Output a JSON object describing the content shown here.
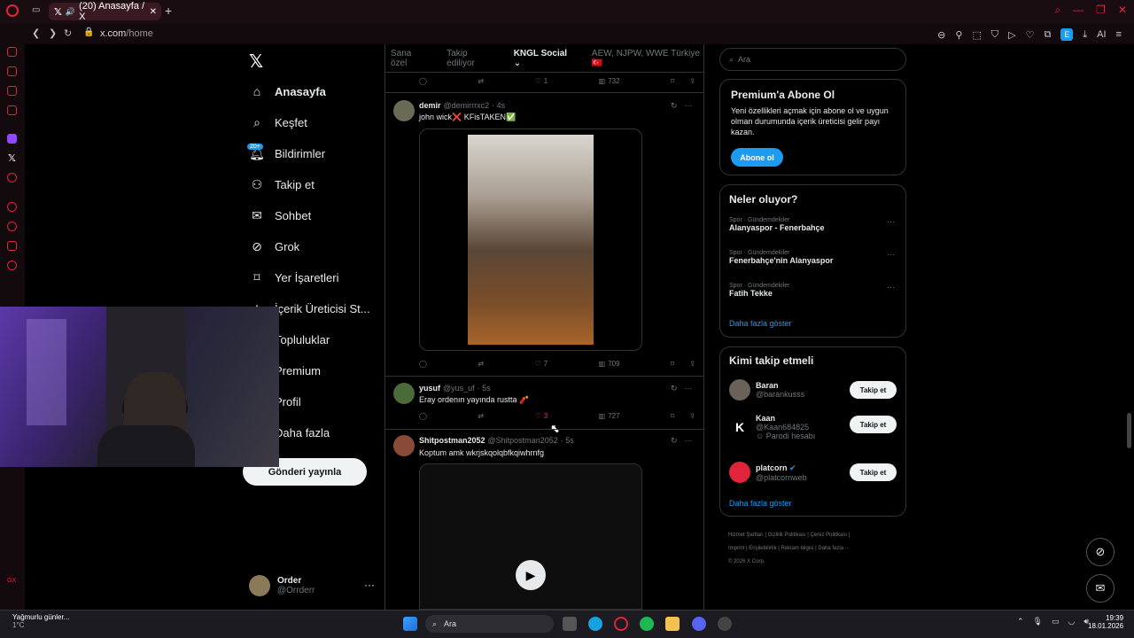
{
  "browser": {
    "tab_title": "(20) Anasayfa / X",
    "url_host": "x.com",
    "url_path": "/home",
    "ext_letter": "E",
    "ai_label": "AI"
  },
  "nav": {
    "logo": "𝕏",
    "items": [
      {
        "label": "Anasayfa",
        "icon": "home-icon"
      },
      {
        "label": "Keşfet",
        "icon": "search-icon"
      },
      {
        "label": "Bildirimler",
        "icon": "bell-icon"
      },
      {
        "label": "Takip et",
        "icon": "follow-icon"
      },
      {
        "label": "Sohbet",
        "icon": "mail-icon"
      },
      {
        "label": "Grok",
        "icon": "grok-icon"
      },
      {
        "label": "Yer İşaretleri",
        "icon": "bookmark-icon"
      },
      {
        "label": "İçerik Üreticisi St...",
        "icon": "creator-icon"
      },
      {
        "label": "Topluluklar",
        "icon": "communities-icon"
      },
      {
        "label": "Premium",
        "icon": "premium-icon"
      },
      {
        "label": "Profil",
        "icon": "profile-icon"
      },
      {
        "label": "Daha fazla",
        "icon": "more-icon"
      }
    ],
    "notif_badge": "20+",
    "post_button": "Gönderi yayınla",
    "account_name": "Order",
    "account_handle": "@Orrderr",
    "account_more": "···"
  },
  "feed": {
    "tabs": [
      "Sana özel",
      "Takip ediliyor",
      "KNGL Social",
      "AEW, NJPW, WWE Türkiye 🇹🇷"
    ],
    "top_actions": {
      "likes": "1",
      "views": "732"
    },
    "tweets": [
      {
        "name": "demir",
        "handle": "@demirrrxc2",
        "time": "· 4s",
        "text": "john wick❌ KFisTAKEN✅",
        "likes": "7",
        "views": "709"
      },
      {
        "name": "yusuf",
        "handle": "@yus_uf",
        "time": "· 5s",
        "text": "Eray ordenın yayında rustta 🧨",
        "likes": "3",
        "views": "727"
      },
      {
        "name": "Shitpostman2052",
        "handle": "@Shitpostman2052",
        "time": "· 5s",
        "text": "Koptum amk wkrjskqolqbfkqiwhrnfg"
      }
    ]
  },
  "right": {
    "search_placeholder": "Ara",
    "premium_title": "Premium'a Abone Ol",
    "premium_desc": "Yeni özellikleri açmak için abone ol ve uygun olman durumunda içerik üreticisi gelir payı kazan.",
    "premium_button": "Abone ol",
    "trends_title": "Neler oluyor?",
    "trends": [
      {
        "cat": "Spor · Gündemdekiler",
        "name": "Alanyaspor - Fenerbahçe"
      },
      {
        "cat": "Spor · Gündemdekiler",
        "name": "Fenerbahçe'nin Alanyaspor"
      },
      {
        "cat": "Spor · Gündemdekiler",
        "name": "Fatih Tekke"
      }
    ],
    "show_more": "Daha fazla göster",
    "who_title": "Kimi takip etmeli",
    "follow": [
      {
        "name": "Baran",
        "handle": "@barankusss",
        "button": "Takip et"
      },
      {
        "name": "Kaan",
        "handle": "@Kaan684825",
        "note": "Parodi hesabı",
        "button": "Takip et"
      },
      {
        "name": "platcorn",
        "handle": "@platcornweb",
        "button": "Takip et"
      }
    ],
    "footer_lines": [
      "Hizmet Şartları  |  Gizlilik Politikası  |  Çerez Politikası  |",
      "Imprint  |  Erişilebilirlik  |  Reklam bilgisi  |  Daha fazla ···",
      "© 2026 X Corp."
    ]
  },
  "taskbar": {
    "weather": "Yağmurlu günler...",
    "temp": "1°C",
    "search": "Ara",
    "time": "19:39",
    "date": "18.01.2026"
  }
}
